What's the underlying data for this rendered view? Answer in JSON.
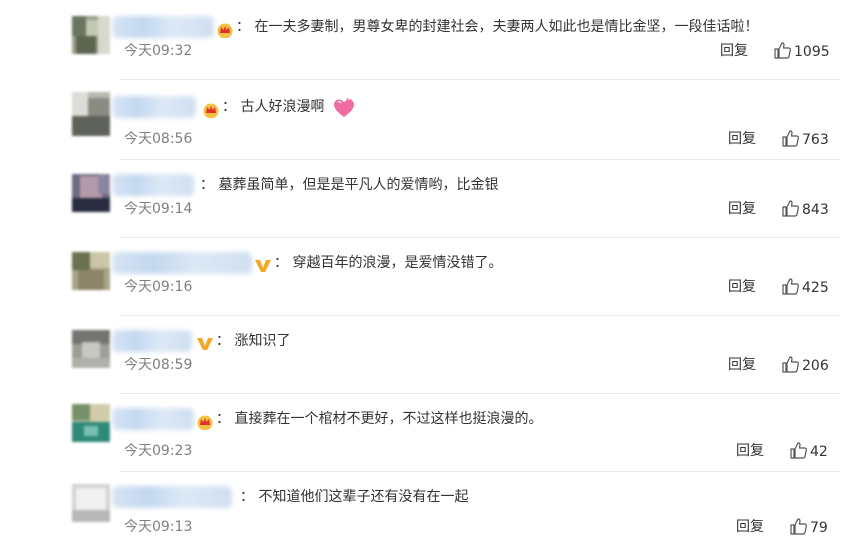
{
  "comments": [
    {
      "sep": "：",
      "text": "在一夫多妻制，男尊女卑的封建社会，夫妻两人如此也是情比金坚，一段佳话啦！",
      "time": "今天09:32",
      "reply": "回复",
      "likes": "1095",
      "badge": "crown-icon"
    },
    {
      "sep": "：",
      "text": "古人好浪漫啊",
      "time": "今天08:56",
      "reply": "回复",
      "likes": "763",
      "badge": "crown-icon",
      "emoji": "pink-heart-icon"
    },
    {
      "sep": "：",
      "text": "墓葬虽简单，但是是平凡人的爱情哟，比金银",
      "time": "今天09:14",
      "reply": "回复",
      "likes": "843",
      "badge": ""
    },
    {
      "sep": "：",
      "text": "穿越百年的浪漫，是爱情没错了。",
      "time": "今天09:16",
      "reply": "回复",
      "likes": "425",
      "badge": "v-icon"
    },
    {
      "sep": "：",
      "text": "涨知识了",
      "time": "今天08:59",
      "reply": "回复",
      "likes": "206",
      "badge": "v-icon"
    },
    {
      "sep": "：",
      "text": "直接葬在一个棺材不更好，不过这样也挺浪漫的。",
      "time": "今天09:23",
      "reply": "回复",
      "likes": "42",
      "badge": "crown-icon"
    },
    {
      "sep": "：",
      "text": "不知道他们这辈子还有没有在一起",
      "time": "今天09:13",
      "reply": "回复",
      "likes": "79",
      "badge": ""
    }
  ],
  "colors": {
    "accent_v": "#f5a623",
    "crown": "#e0322b",
    "link_blue": "#eb7350",
    "divider": "#e8e8e8"
  }
}
